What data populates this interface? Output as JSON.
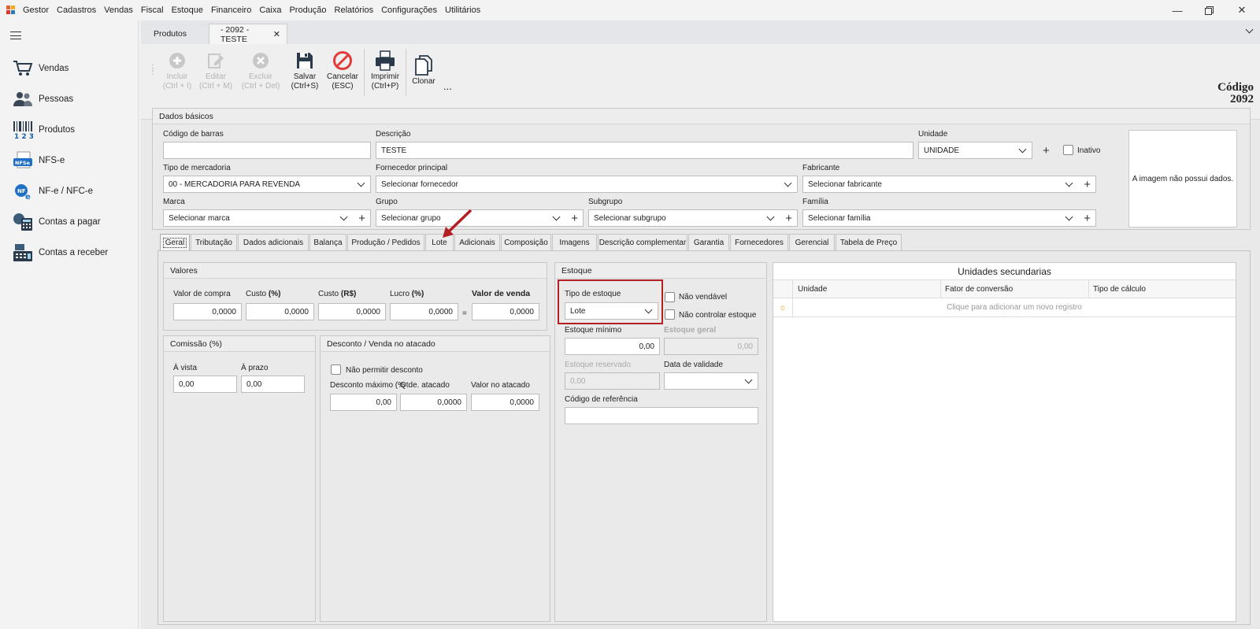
{
  "app": {
    "title": "Gestor"
  },
  "menu": [
    "Cadastros",
    "Vendas",
    "Fiscal",
    "Estoque",
    "Financeiro",
    "Caixa",
    "Produção",
    "Relatórios",
    "Configurações",
    "Utilitários"
  ],
  "window": {
    "minimize_icon": "minimize-icon",
    "restore_icon": "restore-icon",
    "close_icon": "close-icon"
  },
  "sidebar": {
    "items": [
      {
        "label": "Vendas",
        "icon": "cart-icon"
      },
      {
        "label": "Pessoas",
        "icon": "people-icon"
      },
      {
        "label": "Produtos",
        "icon": "barcode-icon"
      },
      {
        "label": "NFS-e",
        "icon": "nfse-icon"
      },
      {
        "label": "NF-e / NFC-e",
        "icon": "nfe-icon"
      },
      {
        "label": "Contas a pagar",
        "icon": "calculator-icon"
      },
      {
        "label": "Contas a receber",
        "icon": "cash-register-icon"
      }
    ]
  },
  "doc_tabs": {
    "tab1": "Produtos",
    "tab2": "- 2092 - TESTE"
  },
  "toolbar": {
    "incluir": [
      "Incluir",
      "(Ctrl + I)"
    ],
    "editar": [
      "Editar",
      "(Ctrl + M)"
    ],
    "excluir": [
      "Excluir",
      "(Ctrl + Del)"
    ],
    "salvar": [
      "Salvar",
      "(Ctrl+S)"
    ],
    "cancelar": [
      "Cancelar",
      "(ESC)"
    ],
    "imprimir": [
      "Imprimir",
      "(Ctrl+P)"
    ],
    "clonar": "Clonar",
    "more": "..."
  },
  "codigo": {
    "label": "Código",
    "value": "2092"
  },
  "dados_basicos": {
    "title": "Dados básicos",
    "codigo_barras": {
      "label": "Código de barras",
      "value": ""
    },
    "descricao": {
      "label": "Descrição",
      "value": "TESTE"
    },
    "unidade": {
      "label": "Unidade",
      "value": "UNIDADE"
    },
    "inativo": "Inativo",
    "tipo_mercadoria": {
      "label": "Tipo de mercadoria",
      "value": "00 - MERCADORIA PARA REVENDA"
    },
    "fornecedor": {
      "label": "Fornecedor principal",
      "value": "Selecionar fornecedor"
    },
    "fabricante": {
      "label": "Fabricante",
      "value": "Selecionar fabricante"
    },
    "marca": {
      "label": "Marca",
      "value": "Selecionar marca"
    },
    "grupo": {
      "label": "Grupo",
      "value": "Selecionar grupo"
    },
    "subgrupo": {
      "label": "Subgrupo",
      "value": "Selecionar subgrupo"
    },
    "familia": {
      "label": "Família",
      "value": "Selecionar família"
    },
    "imagem": "A imagem não possui dados."
  },
  "inner_tabs": [
    "Geral",
    "Tributação",
    "Dados adicionais",
    "Balança",
    "Produção / Pedidos",
    "Lote",
    "Adicionais",
    "Composição",
    "Imagens",
    "Descrição complementar",
    "Garantia",
    "Fornecedores",
    "Gerencial",
    "Tabela de Preço"
  ],
  "valores": {
    "title": "Valores",
    "valor_compra": {
      "label": "Valor de compra",
      "value": "0,0000"
    },
    "custo_pct": {
      "label": "Custo",
      "unit": "(%)",
      "value": "0,0000"
    },
    "custo_rs": {
      "label": "Custo",
      "unit": "(R$)",
      "value": "0,0000"
    },
    "lucro": {
      "label": "Lucro",
      "unit": "(%)",
      "value": "0,0000"
    },
    "eq": "=",
    "valor_venda": {
      "label": "Valor de venda",
      "value": "0,0000"
    }
  },
  "comissao": {
    "title": "Comissão (%)",
    "a_vista": {
      "label": "À vista",
      "value": "0,00"
    },
    "a_prazo": {
      "label": "À prazo",
      "value": "0,00"
    }
  },
  "desconto": {
    "title": "Desconto / Venda no atacado",
    "nao_permitir": "Não permitir desconto",
    "desconto_max": {
      "label": "Desconto máximo (%",
      "value": "0,00"
    },
    "qtde_atacado": {
      "label": "Qtde. atacado",
      "value": "0,0000"
    },
    "valor_atacado": {
      "label": "Valor no atacado",
      "value": "0,0000"
    }
  },
  "estoque": {
    "title": "Estoque",
    "tipo": {
      "label": "Tipo de estoque",
      "value": "Lote"
    },
    "nao_vendavel": "Não vendável",
    "nao_controlar": "Não controlar estoque",
    "minimo": {
      "label": "Estoque mínimo",
      "value": "0,00"
    },
    "geral": {
      "label": "Estoque geral",
      "value": "0,00"
    },
    "reservado": {
      "label": "Estoque reservado",
      "value": "0,00"
    },
    "validade": {
      "label": "Data de validade",
      "value": ""
    },
    "referencia": {
      "label": "Código de referência",
      "value": ""
    }
  },
  "unidades_sec": {
    "title": "Unidades secundarias",
    "columns": [
      "Unidade",
      "Fator de conversão",
      "Tipo de cálculo"
    ],
    "placeholder": "Clique para adicionar um novo registro"
  },
  "colors": {
    "highlight": "#b41f24",
    "accent": "#1a7fd0",
    "cancel": "#e23b3b"
  }
}
